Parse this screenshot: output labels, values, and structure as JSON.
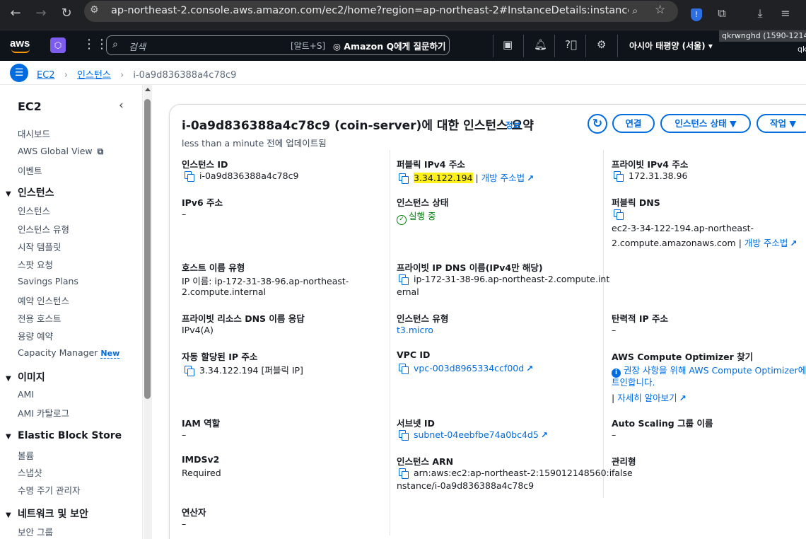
{
  "browser": {
    "url": "ap-northeast-2.console.aws.amazon.com/ec2/home?region=ap-northeast-2#InstanceDetails:instanceId=i-0a9d83..."
  },
  "topnav": {
    "logo": "aws",
    "search_placeholder": "검색",
    "search_shortcut": "[알트+S]",
    "amazon_q": "Amazon Q에게 질문하기",
    "region": "아시아 태평양 (서울)",
    "account_line1": "qkrwnghd (1590-1214-",
    "account_line2": "qk"
  },
  "breadcrumb": {
    "root": "EC2",
    "section": "인스턴스",
    "current": "i-0a9d836388a4c78c9"
  },
  "sidebar": {
    "title": "EC2",
    "top_items": [
      "대시보드",
      "AWS Global View",
      "이벤트"
    ],
    "sections": [
      {
        "title": "인스턴스",
        "items": [
          "인스턴스",
          "인스턴스 유형",
          "시작 템플릿",
          "스팟 요청",
          "Savings Plans",
          "예약 인스턴스",
          "전용 호스트",
          "용량 예약",
          "Capacity Manager"
        ]
      },
      {
        "title": "이미지",
        "items": [
          "AMI",
          "AMI 카탈로그"
        ]
      },
      {
        "title": "Elastic Block Store",
        "items": [
          "볼륨",
          "스냅샷",
          "수명 주기 관리자"
        ]
      },
      {
        "title": "네트워크 및 보안",
        "items": [
          "보안 그룹"
        ]
      }
    ],
    "new_badge": "New"
  },
  "summary": {
    "title": "i-0a9d836388a4c78c9 (coin-server)에 대한 인스턴스 요약",
    "info": "정보",
    "updated": "less than a minute 전에 업데이트됨",
    "buttons": {
      "connect": "연결",
      "state": "인스턴스 상태",
      "actions": "작업"
    }
  },
  "fields": {
    "instance_id_label": "인스턴스 ID",
    "instance_id": "i-0a9d836388a4c78c9",
    "public_ipv4_label": "퍼블릭 IPv4 주소",
    "public_ipv4": "3.34.122.194",
    "open_address": "개방 주소법",
    "private_ipv4_label": "프라이빗 IPv4 주소",
    "private_ipv4": "172.31.38.96",
    "ipv6_label": "IPv6 주소",
    "ipv6": "–",
    "instance_state_label": "인스턴스 상태",
    "instance_state": "실행 중",
    "public_dns_label": "퍼블릭 DNS",
    "public_dns_line1": "ec2-3-34-122-194.ap-northeast-",
    "public_dns_line2": "2.compute.amazonaws.com",
    "hostname_type_label": "호스트 이름 유형",
    "hostname_type_line1": "IP 이름: ip-172-31-38-96.ap-northeast-",
    "hostname_type_line2": "2.compute.internal",
    "private_dns_label": "프라이빗 IP DNS 이름(IPv4만 해당)",
    "private_dns_line1": "ip-172-31-38-96.ap-northeast-2.compute.int",
    "private_dns_line2": "ernal",
    "private_resource_dns_label": "프라이빗 리소스 DNS 이름 응답",
    "private_resource_dns": "IPv4(A)",
    "instance_type_label": "인스턴스 유형",
    "instance_type": "t3.micro",
    "elastic_ip_label": "탄력적 IP 주소",
    "elastic_ip": "–",
    "auto_ip_label": "자동 할당된 IP 주소",
    "auto_ip": "3.34.122.194 [퍼블릭 IP]",
    "vpc_label": "VPC ID",
    "vpc": "vpc-003d8965334ccf00d",
    "optimizer_label": "AWS Compute Optimizer 찾기",
    "optimizer_line1": "권장 사항을 위해 AWS Compute Optimizer에 옵",
    "optimizer_line2": "트인합니다.",
    "learn_more": "자세히 알아보기",
    "iam_label": "IAM 역할",
    "iam": "–",
    "subnet_label": "서브넷 ID",
    "subnet": "subnet-04eebfbe74a0bc4d5",
    "asg_label": "Auto Scaling 그룹 이름",
    "asg": "–",
    "imds_label": "IMDSv2",
    "imds": "Required",
    "arn_label": "인스턴스 ARN",
    "arn_line1": "arn:aws:ec2:ap-northeast-2:159012148560:i",
    "arn_line2": "nstance/i-0a9d836388a4c78c9",
    "managed_label": "관리형",
    "managed": "false",
    "operator_label": "연산자",
    "operator": "–"
  }
}
